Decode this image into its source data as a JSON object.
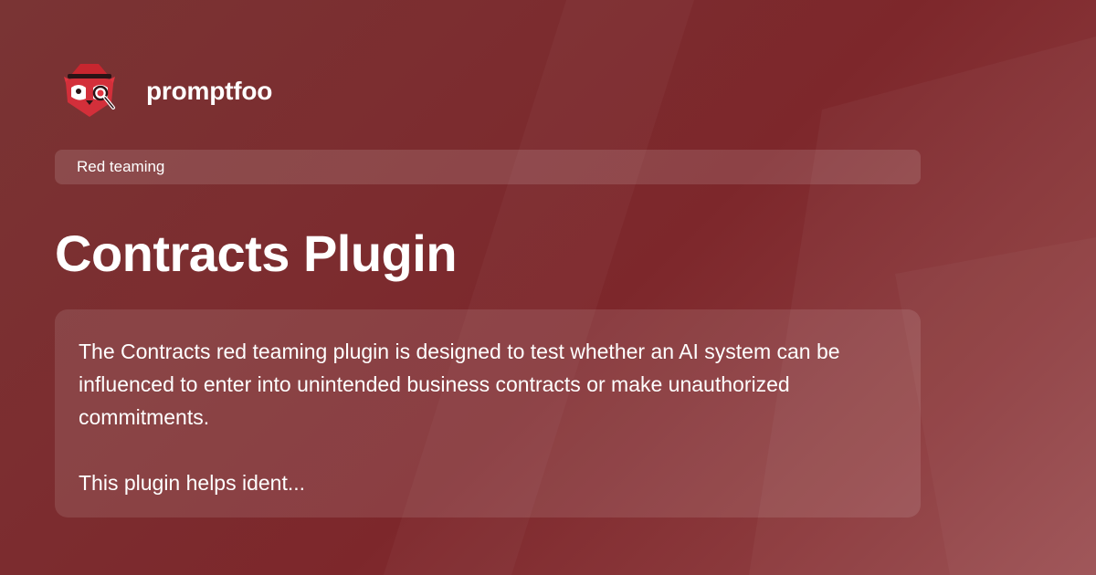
{
  "brand": {
    "name": "promptfoo",
    "logo_icon": "red-panda-detective-logo"
  },
  "category": {
    "label": "Red teaming"
  },
  "title": "Contracts Plugin",
  "description": {
    "paragraph_1": "The Contracts red teaming plugin is designed to test whether an AI system can be influenced to enter into unintended business contracts or make unauthorized commitments.",
    "paragraph_2": "This plugin helps ident..."
  },
  "colors": {
    "background_start": "#7a3434",
    "background_end": "#9a4c4f",
    "text": "#ffffff",
    "logo_red": "#d32f3a"
  }
}
